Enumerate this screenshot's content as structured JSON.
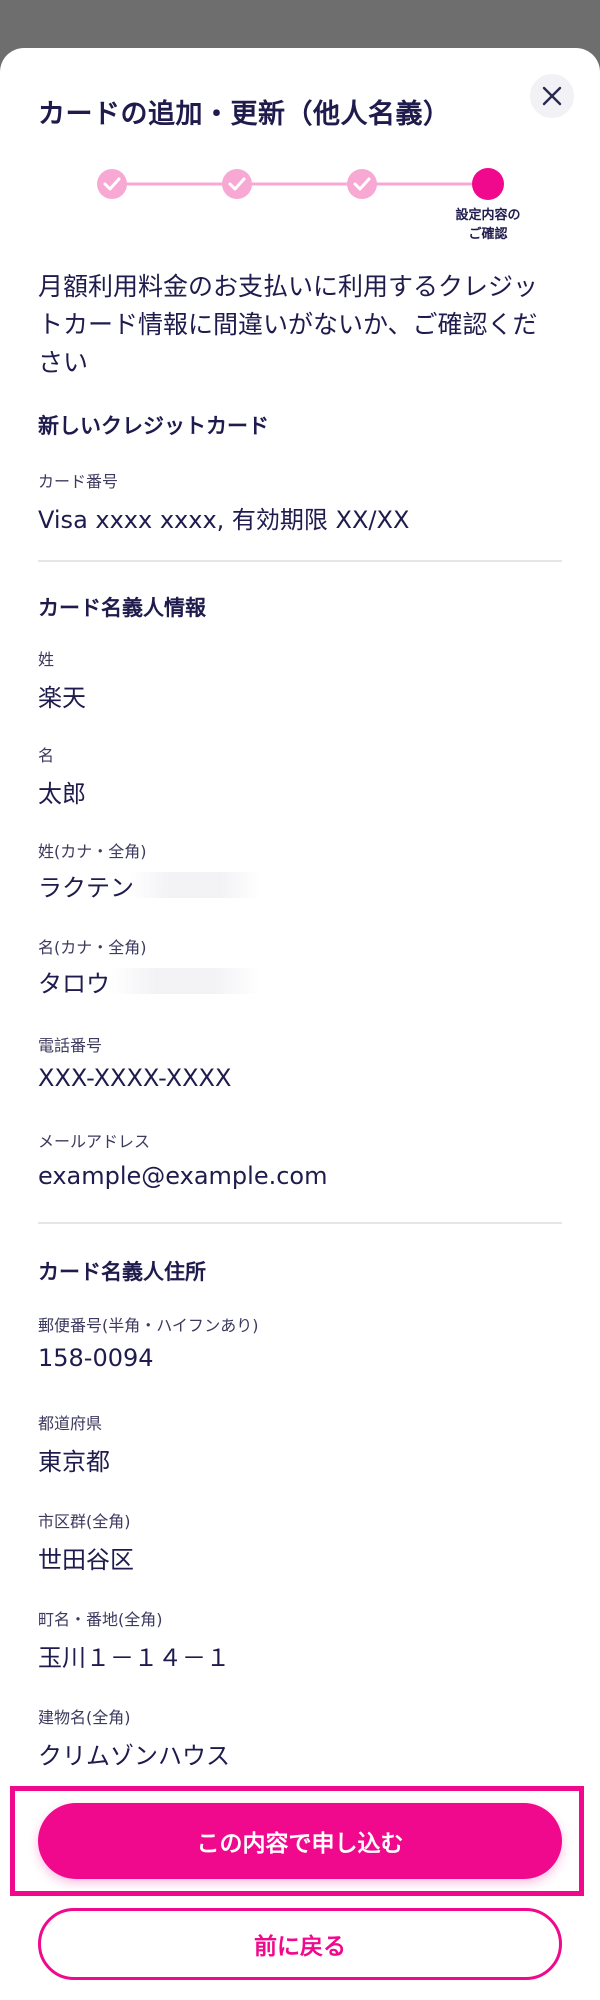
{
  "modal": {
    "title": "カードの追加・更新（他人名義）",
    "close_icon": "close-icon"
  },
  "stepper": {
    "steps": [
      {
        "state": "done",
        "icon": "check-icon",
        "label": ""
      },
      {
        "state": "done",
        "icon": "check-icon",
        "label": ""
      },
      {
        "state": "done",
        "icon": "check-icon",
        "label": ""
      },
      {
        "state": "current",
        "icon": "",
        "label_line1": "設定内容の",
        "label_line2": "ご確認"
      }
    ]
  },
  "intro_text": "月額利用料金のお支払いに利用するクレジットカード情報に間違いがないか、ご確認ください",
  "new_card": {
    "heading": "新しいクレジットカード",
    "card_number_label": "カード番号",
    "card_number_value": "Visa xxxx xxxx, 有効期限 XX/XX"
  },
  "holder_info": {
    "heading": "カード名義人情報",
    "fields": [
      {
        "label": "姓",
        "value": "楽天"
      },
      {
        "label": "名",
        "value": "太郎"
      },
      {
        "label": "姓(カナ・全角)",
        "value": "ラクテン"
      },
      {
        "label": "名(カナ・全角)",
        "value": "タロウ"
      },
      {
        "label": "電話番号",
        "value": "XXX-XXXX-XXXX"
      },
      {
        "label": "メールアドレス",
        "value": "example@example.com"
      }
    ]
  },
  "holder_address": {
    "heading": "カード名義人住所",
    "fields": [
      {
        "label": "郵便番号(半角・ハイフンあり)",
        "value": "158-0094"
      },
      {
        "label": "都道府県",
        "value": "東京都"
      },
      {
        "label": "市区群(全角)",
        "value": "世田谷区"
      },
      {
        "label": "町名・番地(全角)",
        "value": "玉川１－１４－１"
      },
      {
        "label": "建物名(全角)",
        "value": "クリムゾンハウス"
      }
    ]
  },
  "actions": {
    "submit_label": "この内容で申し込む",
    "back_label": "前に戻る"
  },
  "colors": {
    "accent": "#f0098c",
    "accent_light": "#f7a9d4",
    "text": "#1f1c4d",
    "overlay": "#6e6e6e"
  }
}
